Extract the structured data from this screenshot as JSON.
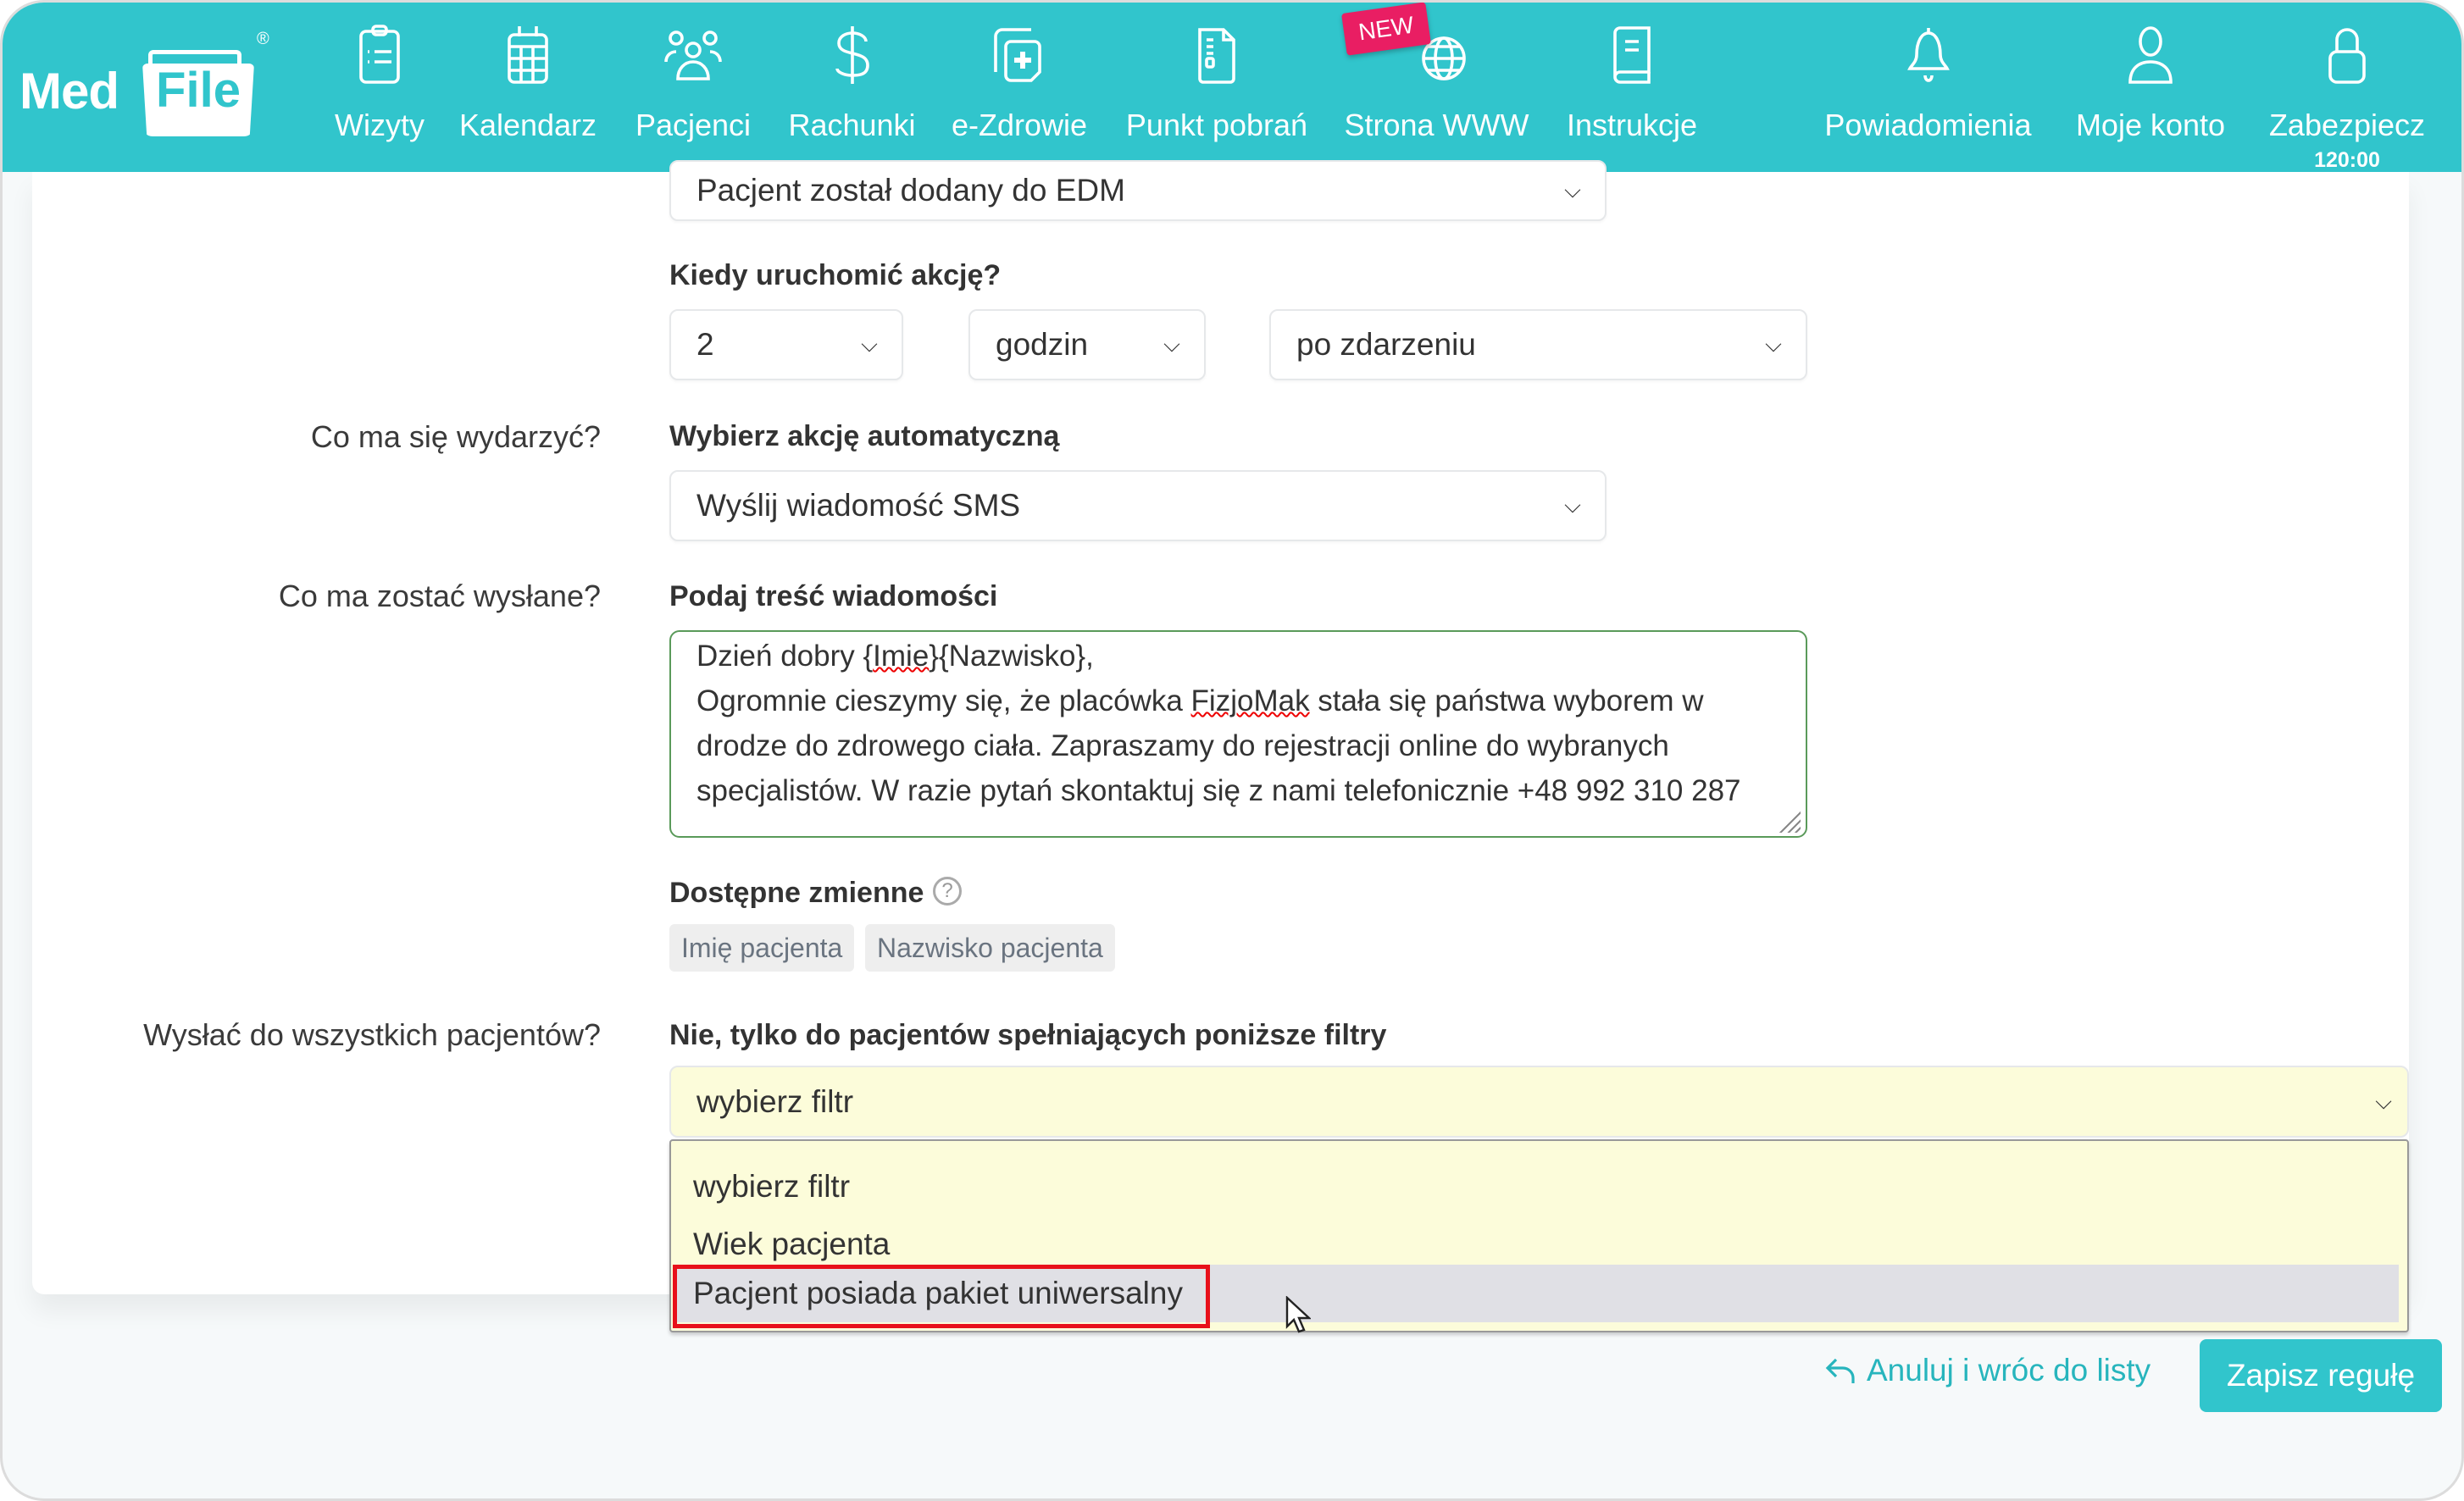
{
  "brand": {
    "name_left": "Med",
    "name_right": "File",
    "registered": "®",
    "accent": "#31C5CC"
  },
  "nav": {
    "items": [
      {
        "label": "Wizyty",
        "icon": "clipboard-list-icon"
      },
      {
        "label": "Kalendarz",
        "icon": "calendar-icon"
      },
      {
        "label": "Pacjenci",
        "icon": "users-icon"
      },
      {
        "label": "Rachunki",
        "icon": "dollar-icon"
      },
      {
        "label": "e-Zdrowie",
        "icon": "medical-card-icon"
      },
      {
        "label": "Punkt pobrań",
        "icon": "document-icon"
      },
      {
        "label": "Strona WWW",
        "icon": "globe-icon",
        "badge": "NEW"
      },
      {
        "label": "Instrukcje",
        "icon": "book-icon"
      },
      {
        "label": "Powiadomienia",
        "icon": "bell-icon"
      },
      {
        "label": "Moje konto",
        "icon": "user-icon"
      },
      {
        "label": "Zabezpiecz",
        "icon": "lock-icon",
        "sub": "120:00"
      }
    ]
  },
  "form": {
    "trigger_select_value": "Pacjent został dodany do EDM",
    "when": {
      "label": "Kiedy uruchomić akcję?",
      "amount": "2",
      "unit": "godzin",
      "relation": "po zdarzeniu"
    },
    "action": {
      "side_label": "Co ma się wydarzyć?",
      "label": "Wybierz akcję automatyczną",
      "value": "Wyślij wiadomość SMS"
    },
    "message": {
      "side_label": "Co ma zostać wysłane?",
      "label": "Podaj treść wiadomości",
      "line1_a": "Dzień dobry {",
      "line1_sq": "Imie",
      "line1_b": "}{Nazwisko},",
      "line2_a": "Ogromnie cieszymy się, że placówka ",
      "line2_sq": "FizjoMak",
      "line2_b": " stała się państwa wyborem w drodze do zdrowego ciała. Zapraszamy do rejestracji online do wybranych specjalistów. W razie pytań skontaktuj się z nami telefonicznie +48 992 310 287"
    },
    "variables": {
      "label": "Dostępne zmienne",
      "help": "?",
      "chips": [
        "Imię pacjenta",
        "Nazwisko pacjenta"
      ]
    },
    "recipients": {
      "side_label": "Wysłać do wszystkich pacjentów?",
      "label": "Nie, tylko do pacjentów spełniających poniższe filtry",
      "filter_value": "wybierz filtr",
      "options": [
        "wybierz filtr",
        "Wiek pacjenta",
        "Pacjent posiada pakiet uniwersalny"
      ],
      "highlighted_option": "Pacjent posiada pakiet uniwersalny"
    }
  },
  "footer": {
    "cancel_label": "Anuluj i wróc do listy",
    "save_label": "Zapisz regułę"
  }
}
